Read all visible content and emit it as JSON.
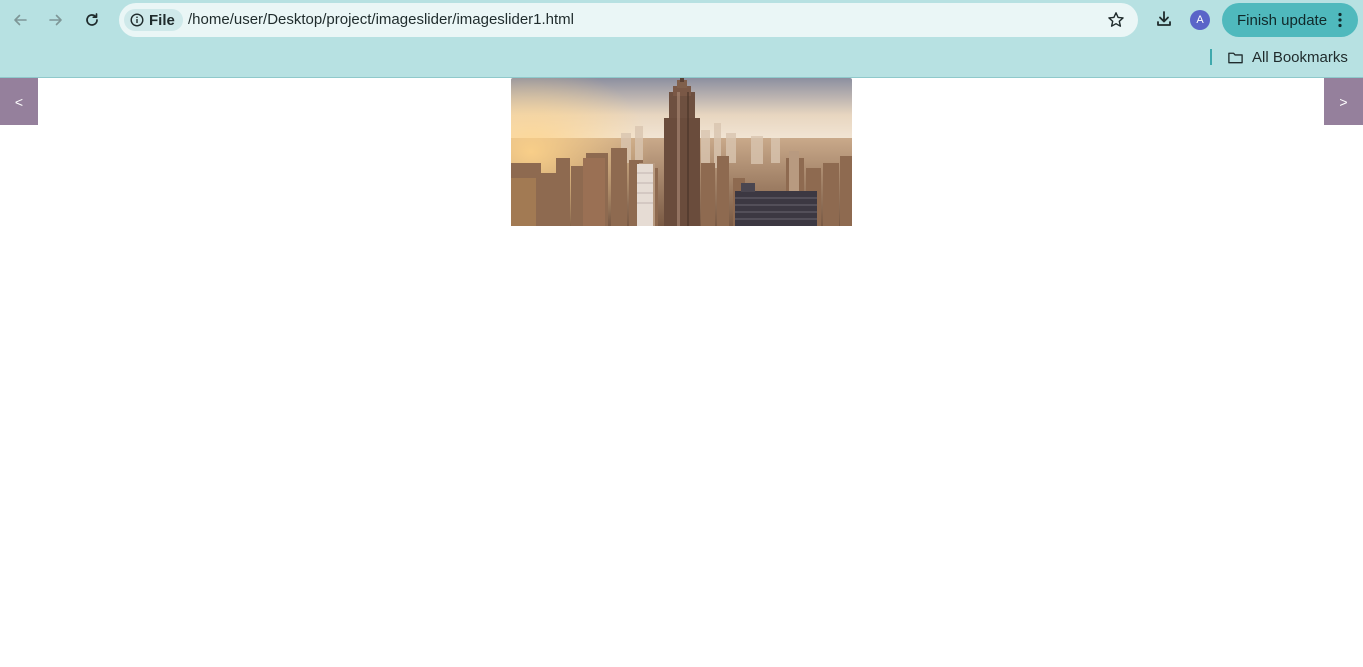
{
  "browser": {
    "file_chip_label": "File",
    "url": "/home/user/Desktop/project/imageslider/imageslider1.html",
    "avatar_initial": "A",
    "update_button_label": "Finish update",
    "bookmarks_label": "All Bookmarks",
    "colors": {
      "chrome_bg": "#b7e1e2",
      "omnibox_bg": "#eaf6f6",
      "update_button_bg": "#4fb9bd",
      "avatar_bg": "#5a64c8"
    }
  },
  "slider": {
    "prev_label": "<",
    "next_label": ">",
    "arrow_color": "#95809c",
    "image_alt": "city skyline with skyscraper"
  }
}
